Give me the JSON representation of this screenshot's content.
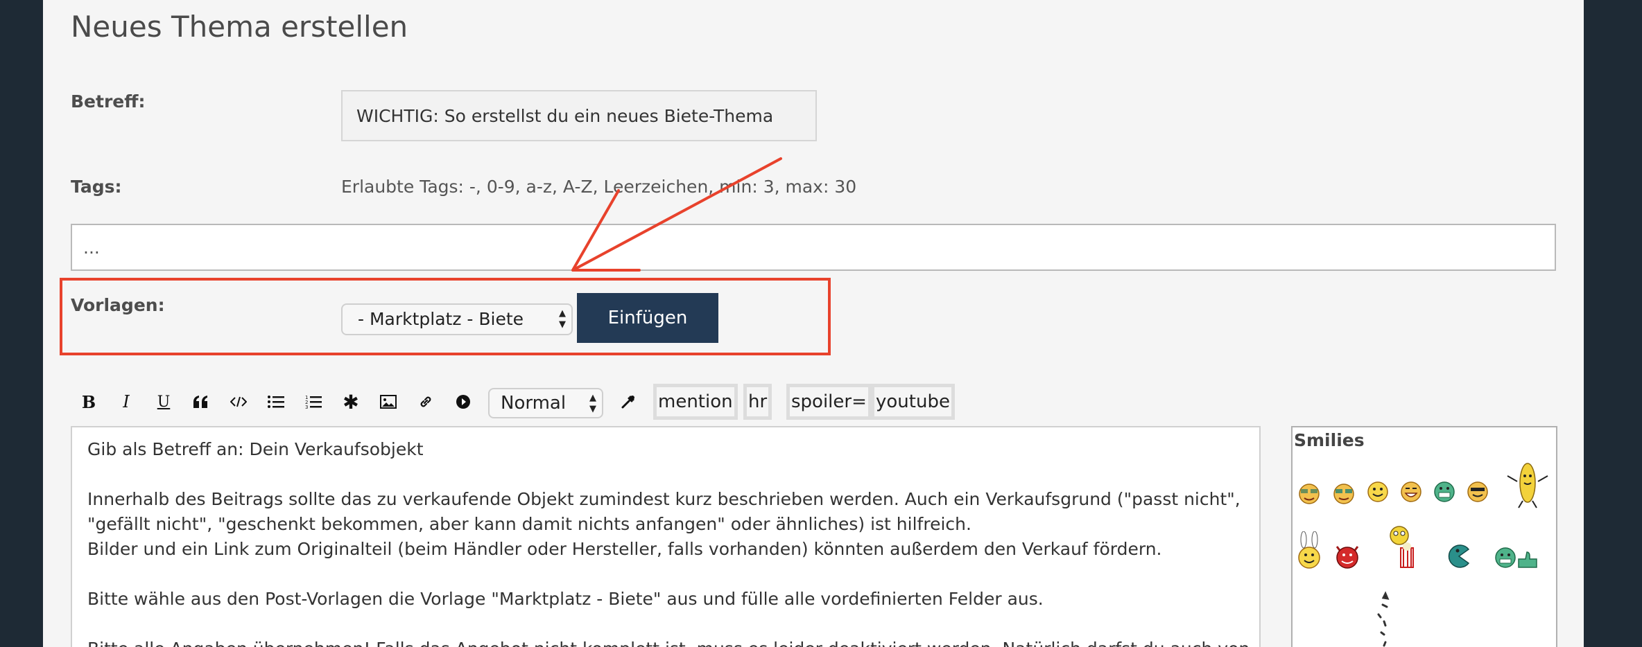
{
  "form": {
    "title": "Neues Thema erstellen",
    "subject_label": "Betreff:",
    "subject_value": "WICHTIG: So erstellst du ein neues Biete-Thema",
    "tags_label": "Tags:",
    "tags_hint": "Erlaubte Tags: -, 0-9, a-z, A-Z, Leerzeichen, min: 3, max: 30",
    "tags_placeholder": "...",
    "templates_label": "Vorlagen:",
    "template_selected": "- Marktplatz - Biete",
    "insert_label": "Einfügen"
  },
  "toolbar": {
    "format_selected": "Normal",
    "tag_buttons": [
      "mention",
      "hr",
      "spoiler=",
      "youtube"
    ]
  },
  "editor": {
    "lines": [
      "Gib als Betreff an: Dein Verkaufsobjekt",
      "",
      "Innerhalb des Beitrags sollte das zu verkaufende Objekt zumindest kurz beschrieben werden. Auch ein Verkaufsgrund (\"passt nicht\",",
      "\"gefällt nicht\", \"geschenkt bekommen, aber kann damit nichts anfangen\" oder ähnliches) ist hilfreich.",
      "Bilder und ein Link zum Originalteil (beim Händler oder Hersteller, falls vorhanden) könnten außerdem den Verkauf fördern.",
      "",
      "Bitte wähle aus den Post-Vorlagen die Vorlage \"Marktplatz - Biete\" aus und fülle alle vordefinierten Felder aus.",
      "",
      "Bitte alle Angaben übernehmen! Falls das Angebot nicht komplett ist, muss es leider deaktiviert werden. Natürlich darfst du auch von"
    ]
  },
  "smilies": {
    "title": "Smilies"
  },
  "colors": {
    "page_background": "#1e2a35",
    "panel_background": "#f5f5f5",
    "button_background": "#233a55",
    "highlight": "#e8422c"
  },
  "icons": [
    "bold-icon",
    "italic-icon",
    "underline-icon",
    "quote-icon",
    "code-icon",
    "bullet-list-icon",
    "numbered-list-icon",
    "asterisk-icon",
    "image-icon",
    "link-icon",
    "video-icon",
    "color-picker-icon"
  ]
}
